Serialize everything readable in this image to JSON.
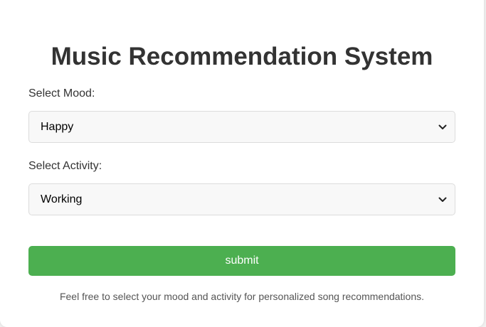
{
  "title": "Music Recommendation System",
  "mood": {
    "label": "Select Mood:",
    "selected": "Happy"
  },
  "activity": {
    "label": "Select Activity:",
    "selected": "Working"
  },
  "submit_label": "submit",
  "footer_text": "Feel free to select your mood and activity for personalized song recommendations.",
  "colors": {
    "accent": "#4caf50",
    "title": "#333333",
    "select_bg": "#f8f8f8"
  },
  "icons": {
    "dropdown": "chevron-down-icon"
  }
}
